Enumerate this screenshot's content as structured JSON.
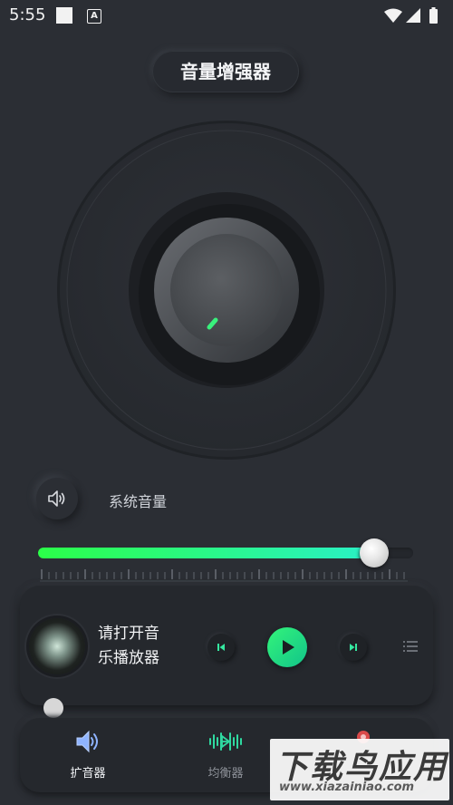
{
  "status_bar": {
    "time": "5:55",
    "notification_icon": "A"
  },
  "header": {
    "title": "音量增强器"
  },
  "volume": {
    "label": "系统音量",
    "level": 0.9
  },
  "player": {
    "line1": "请打开音",
    "line2": "乐播放器"
  },
  "nav": {
    "items": [
      {
        "label": "扩音器",
        "icon": "speaker-icon",
        "active": true
      },
      {
        "label": "均衡器",
        "icon": "waveform-icon",
        "active": false
      },
      {
        "label": "",
        "icon": "pin-icon",
        "active": false
      }
    ]
  },
  "watermark": {
    "big": "下载鸟应用",
    "small": "www.xiazainiao.com"
  },
  "colors": {
    "accent_green": "#2bff48",
    "accent_cyan": "#2af0c8",
    "background": "#2b2e34",
    "nav_active": "#8fb4ff"
  }
}
